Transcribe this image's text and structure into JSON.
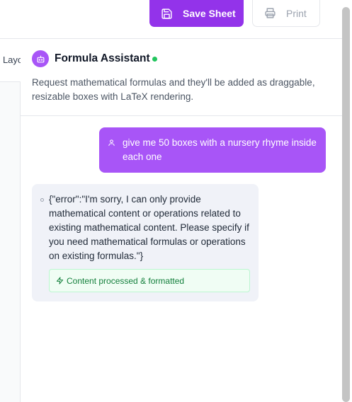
{
  "toolbar": {
    "save_label": "Save Sheet",
    "save_icon": "floppy-disk-icon",
    "print_label": "Print",
    "print_icon": "printer-icon"
  },
  "left_pane": {
    "tab_label": "Layout"
  },
  "assistant": {
    "title": "Formula Assistant",
    "status": "online",
    "description": "Request mathematical formulas and they'll be added as draggable, resizable boxes with LaTeX rendering.",
    "avatar_icon": "robot-icon"
  },
  "messages": [
    {
      "role": "user",
      "icon": "user-icon",
      "text": "give me 50 boxes with a nursery rhyme inside each one"
    },
    {
      "role": "assistant",
      "text": "{\"error\":\"I'm sorry, I can only provide mathematical content or operations related to existing mathematical content. Please specify if you need mathematical formulas or operations on existing formulas.\"}",
      "status_chip": "Content processed & formatted",
      "status_icon": "lightning-icon"
    }
  ],
  "colors": {
    "accent": "#9333ea",
    "user_bubble": "#a855f7",
    "online": "#22c55e",
    "success": "#15803d"
  }
}
